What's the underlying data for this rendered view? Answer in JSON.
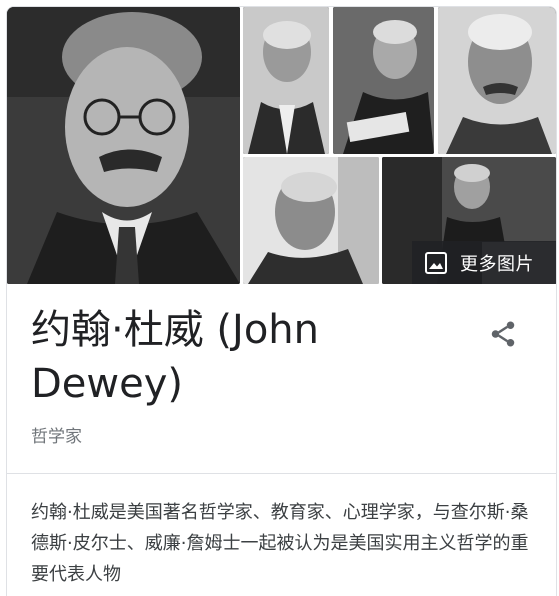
{
  "gallery": {
    "more_images_label": "更多图片"
  },
  "entity": {
    "title": "约翰·杜威 (John Dewey)",
    "subtitle": "哲学家",
    "description": "约翰·杜威是美国著名哲学家、教育家、心理学家，与查尔斯·桑德斯·皮尔士、威廉·詹姆士一起被认为是美国实用主义哲学的重要代表人物"
  },
  "icons": {
    "more_images": "image-icon",
    "share": "share-icon"
  },
  "colors": {
    "title": "#202124",
    "subtitle": "#70757a",
    "description": "#3c4043",
    "share_icon": "#5f6368"
  }
}
